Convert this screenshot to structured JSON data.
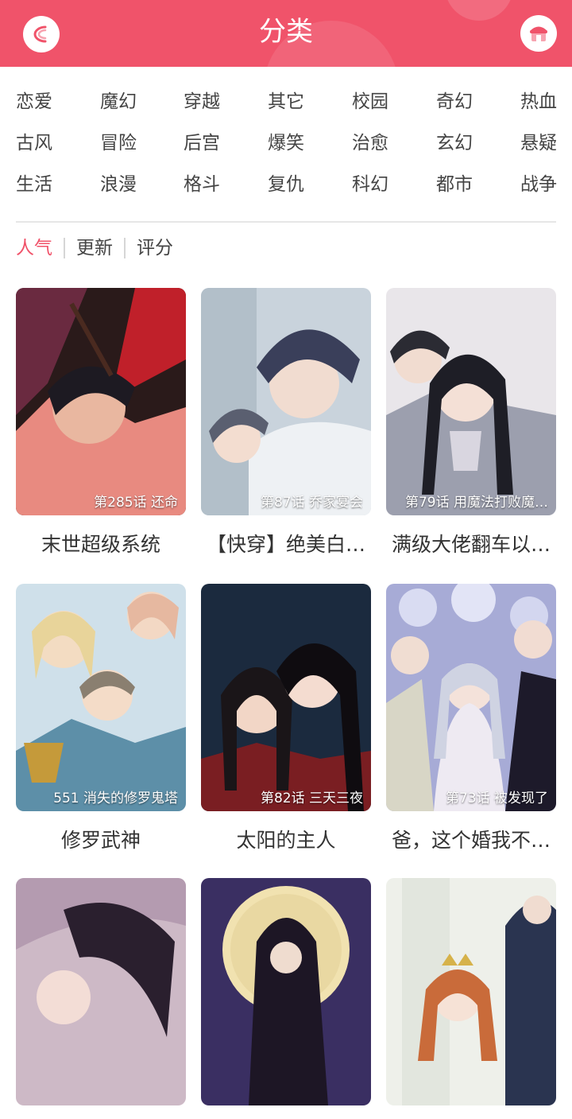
{
  "header": {
    "title": "分类",
    "accent": "#f0536a"
  },
  "categories": [
    [
      "恋爱",
      "魔幻",
      "穿越",
      "其它",
      "校园",
      "奇幻",
      "热血"
    ],
    [
      "古风",
      "冒险",
      "后宫",
      "爆笑",
      "治愈",
      "玄幻",
      "悬疑"
    ],
    [
      "生活",
      "浪漫",
      "格斗",
      "复仇",
      "科幻",
      "都市",
      "战争"
    ]
  ],
  "sort": {
    "items": [
      "人气",
      "更新",
      "评分"
    ],
    "active": "人气"
  },
  "comics": [
    {
      "title": "末世超级系统",
      "chapter": "第285话 还命"
    },
    {
      "title": "【快穿】绝美白…",
      "chapter": "第87话 乔家宴会"
    },
    {
      "title": "满级大佬翻车以…",
      "chapter": "第79话 用魔法打败魔…"
    },
    {
      "title": "修罗武神",
      "chapter": "551 消失的修罗鬼塔"
    },
    {
      "title": "太阳的主人",
      "chapter": "第82话 三天三夜"
    },
    {
      "title": "爸，这个婚我不…",
      "chapter": "第73话 被发现了"
    },
    {
      "title": "",
      "chapter": ""
    },
    {
      "title": "",
      "chapter": ""
    },
    {
      "title": "",
      "chapter": ""
    }
  ]
}
